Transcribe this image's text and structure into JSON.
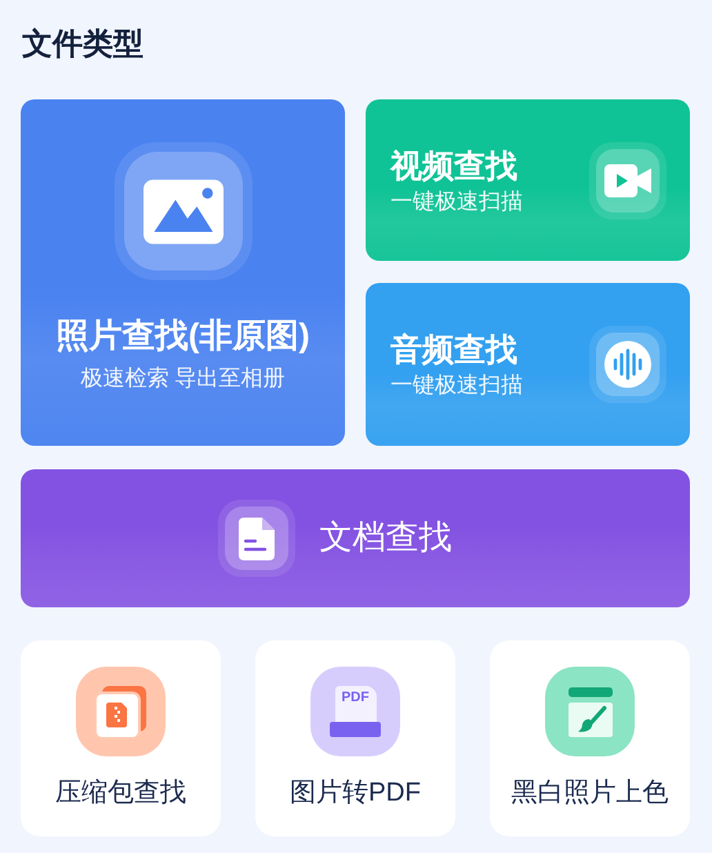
{
  "section_title": "文件类型",
  "features": [
    {
      "kind": "large",
      "title": "照片查找(非原图)",
      "subtitle": "极速检索 导出至相册",
      "color": "#4a82f0"
    },
    {
      "kind": "small",
      "title": "视频查找",
      "subtitle": "一键极速扫描",
      "color": "#10c396"
    },
    {
      "kind": "small",
      "title": "音频查找",
      "subtitle": "一键极速扫描",
      "color": "#33a0f0"
    },
    {
      "kind": "wide",
      "title": "文档查找",
      "color": "#8452e2"
    }
  ],
  "tools": [
    {
      "label": "压缩包查找"
    },
    {
      "icon_text": "PDF",
      "label": "图片转PDF"
    },
    {
      "label": "黑白照片上色"
    }
  ]
}
